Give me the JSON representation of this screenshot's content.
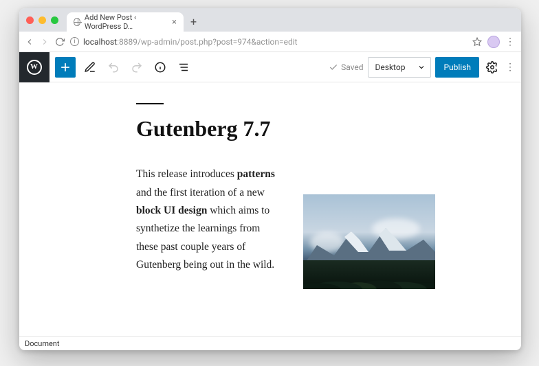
{
  "browser": {
    "tab_title": "Add New Post ‹ WordPress D…",
    "url_host": "localhost",
    "url_path": ":8889/wp-admin/post.php?post=974&action=edit"
  },
  "toolbar": {
    "saved_label": "Saved",
    "preview_label": "Desktop",
    "publish_label": "Publish"
  },
  "post": {
    "title": "Gutenberg 7.7",
    "para_1": "This release introduces ",
    "para_1_b": "patterns",
    "para_2": " and the first iteration of a new ",
    "para_2_b": "block UI design",
    "para_3": " which aims to synthetize the learnings from these past couple years of Gutenberg being out in the wild."
  },
  "footer": {
    "document_label": "Document"
  }
}
